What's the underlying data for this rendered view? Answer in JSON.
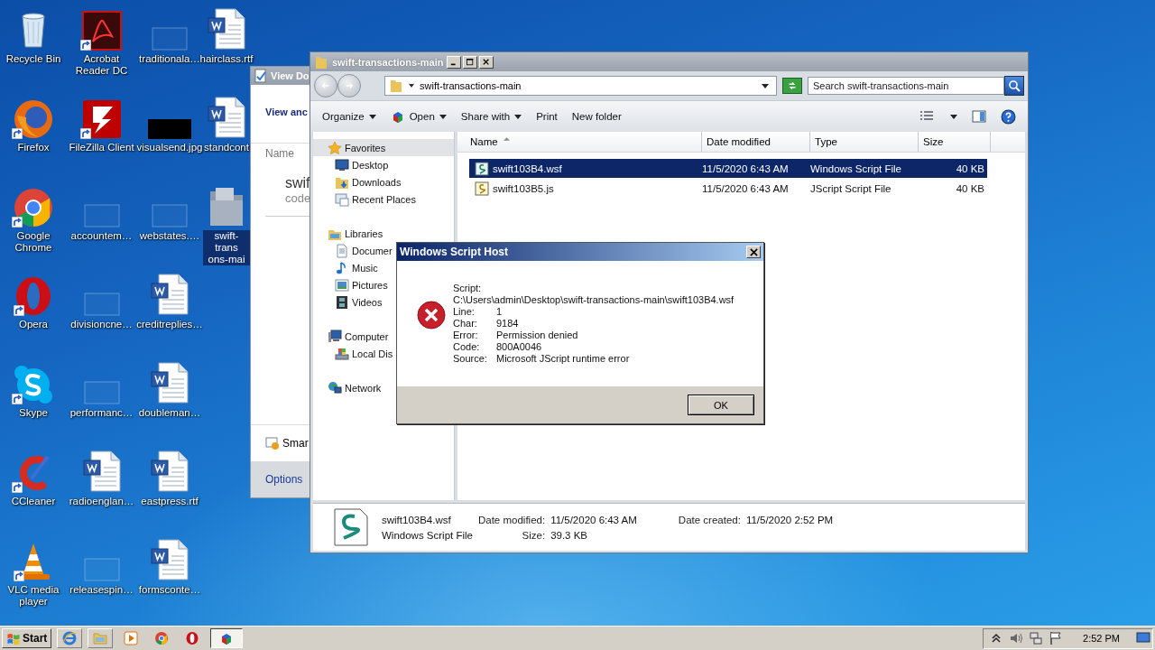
{
  "desktop": {
    "icons": [
      {
        "label": "Recycle Bin",
        "kind": "recycle",
        "shortcut": false,
        "selected": false
      },
      {
        "label": "Firefox",
        "kind": "firefox",
        "shortcut": true,
        "selected": false
      },
      {
        "label": "Google Chrome",
        "kind": "chrome",
        "shortcut": true,
        "selected": false
      },
      {
        "label": "Opera",
        "kind": "opera",
        "shortcut": true,
        "selected": false
      },
      {
        "label": "Skype",
        "kind": "skype",
        "shortcut": true,
        "selected": false
      },
      {
        "label": "CCleaner",
        "kind": "ccleaner",
        "shortcut": true,
        "selected": false
      },
      {
        "label": "VLC media player",
        "kind": "vlc",
        "shortcut": true,
        "selected": false
      },
      {
        "label": "Acrobat Reader DC",
        "kind": "acrobat",
        "shortcut": true,
        "selected": false
      },
      {
        "label": "FileZilla Client",
        "kind": "filezilla",
        "shortcut": true,
        "selected": false
      },
      {
        "label": "accountem…",
        "kind": "blank",
        "shortcut": false,
        "selected": false
      },
      {
        "label": "divisioncne…",
        "kind": "blank",
        "shortcut": false,
        "selected": false
      },
      {
        "label": "performanc…",
        "kind": "blank",
        "shortcut": false,
        "selected": false
      },
      {
        "label": "radioenglan…",
        "kind": "word",
        "shortcut": false,
        "selected": false
      },
      {
        "label": "releasespin…",
        "kind": "blank",
        "shortcut": false,
        "selected": false
      },
      {
        "label": "traditionala…",
        "kind": "blank",
        "shortcut": false,
        "selected": false
      },
      {
        "label": "visualsend.jpg",
        "kind": "image",
        "shortcut": false,
        "selected": false
      },
      {
        "label": "webstates.…",
        "kind": "blank",
        "shortcut": false,
        "selected": false
      },
      {
        "label": "creditreplies…",
        "kind": "word",
        "shortcut": false,
        "selected": false
      },
      {
        "label": "doubleman…",
        "kind": "word",
        "shortcut": false,
        "selected": false
      },
      {
        "label": "eastpress.rtf",
        "kind": "word",
        "shortcut": false,
        "selected": false
      },
      {
        "label": "formsconte…",
        "kind": "word",
        "shortcut": false,
        "selected": false
      },
      {
        "label": "hairclass.rtf",
        "kind": "word",
        "shortcut": false,
        "selected": false
      },
      {
        "label": "standcont",
        "kind": "word",
        "shortcut": false,
        "selected": false
      },
      {
        "label": "swift-trans\nons-mai",
        "kind": "folder",
        "shortcut": false,
        "selected": true
      }
    ]
  },
  "back_window": {
    "title": "View Do",
    "heading": "View anc",
    "column": "Name",
    "item_title": "swif",
    "item_subtitle": "code",
    "link": "Smar",
    "footer_button": "Options"
  },
  "explorer": {
    "title": "swift-transactions-main",
    "address": "swift-transactions-main",
    "search": {
      "placeholder": "Search swift-transactions-main"
    },
    "toolbar": [
      {
        "label": "Organize",
        "icon": false,
        "caret": true
      },
      {
        "label": "Open",
        "icon": true,
        "caret": true
      },
      {
        "label": "Share with",
        "icon": false,
        "caret": true
      },
      {
        "label": "Print",
        "icon": false,
        "caret": false
      },
      {
        "label": "New folder",
        "icon": false,
        "caret": false
      }
    ],
    "nav": [
      {
        "label": "Favorites",
        "kind": "favorites",
        "selected": true,
        "children": [
          {
            "label": "Desktop",
            "kind": "desktop",
            "selected": false
          },
          {
            "label": "Downloads",
            "kind": "downloads",
            "selected": false
          },
          {
            "label": "Recent Places",
            "kind": "recent",
            "selected": false
          }
        ]
      },
      {
        "label": "Libraries",
        "kind": "libraries",
        "selected": false,
        "children": [
          {
            "label": "Documer",
            "kind": "documents",
            "selected": false
          },
          {
            "label": "Music",
            "kind": "music",
            "selected": false
          },
          {
            "label": "Pictures",
            "kind": "pictures",
            "selected": false
          },
          {
            "label": "Videos",
            "kind": "videos",
            "selected": false
          }
        ]
      },
      {
        "label": "Computer",
        "kind": "computer",
        "selected": false,
        "children": [
          {
            "label": "Local Dis",
            "kind": "disk",
            "selected": false
          }
        ]
      },
      {
        "label": "Network",
        "kind": "network",
        "selected": false
      }
    ],
    "columns": [
      {
        "label": "Name",
        "sorted": true
      },
      {
        "label": "Date modified",
        "sorted": false
      },
      {
        "label": "Type",
        "sorted": false
      },
      {
        "label": "Size",
        "sorted": false
      }
    ],
    "rows": [
      {
        "name": "swift103B4.wsf",
        "date": "11/5/2020 6:43 AM",
        "type": "Windows Script File",
        "size": "40 KB",
        "kind": "wsf",
        "selected": true
      },
      {
        "name": "swift103B5.js",
        "date": "11/5/2020 6:43 AM",
        "type": "JScript Script File",
        "size": "40 KB",
        "kind": "js",
        "selected": false
      }
    ],
    "details": {
      "name": "swift103B4.wsf",
      "type": "Windows Script File",
      "fields": [
        {
          "label": "Date modified:",
          "value": "11/5/2020 6:43 AM"
        },
        {
          "label": "Date created:",
          "value": "11/5/2020 2:52 PM"
        },
        {
          "label": "Size:",
          "value": "39.3 KB"
        }
      ]
    }
  },
  "dialog": {
    "title": "Windows Script Host",
    "script_label": "Script:",
    "script_path": "C:\\Users\\admin\\Desktop\\swift-transactions-main\\swift103B4.wsf",
    "fields": [
      {
        "label": "Line:",
        "value": "1"
      },
      {
        "label": "Char:",
        "value": "9184"
      },
      {
        "label": "Error:",
        "value": "Permission denied"
      },
      {
        "label": "Code:",
        "value": "800A0046"
      },
      {
        "label": "Source:",
        "value": "Microsoft JScript runtime error"
      }
    ],
    "button": "OK"
  },
  "taskbar": {
    "start": "Start",
    "apps": [
      {
        "kind": "ie",
        "active": false
      },
      {
        "kind": "explorer",
        "active": false
      },
      {
        "kind": "media",
        "active": false
      },
      {
        "kind": "chrome",
        "active": false
      },
      {
        "kind": "opera",
        "active": false
      },
      {
        "kind": "script",
        "active": true
      }
    ],
    "clock": "2:52 PM"
  }
}
